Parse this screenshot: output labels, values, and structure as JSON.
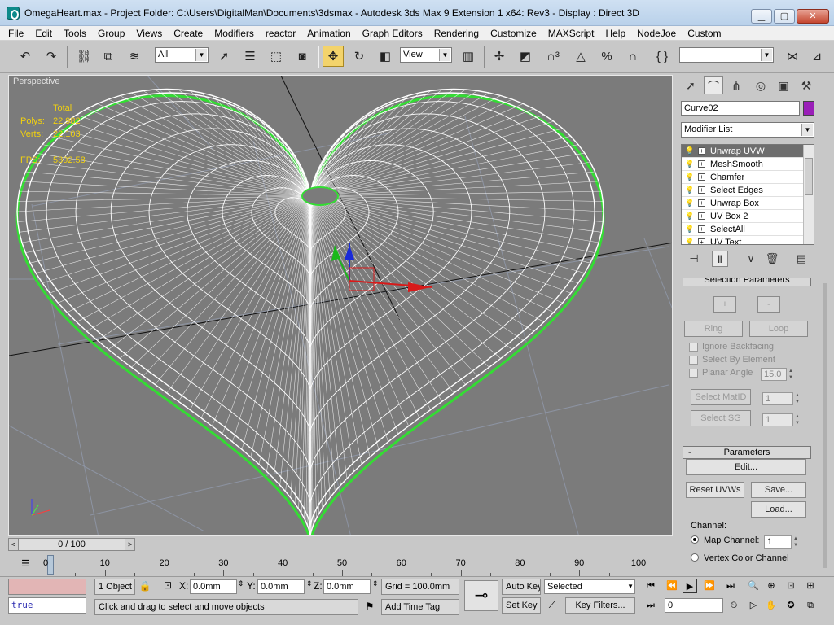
{
  "window": {
    "title": "OmegaHeart.max    - Project Folder: C:\\Users\\DigitalMan\\Documents\\3dsmax    - Autodesk 3ds Max 9 Extension 1 x64: Rev3      - Display : Direct 3D",
    "min_label": "▁",
    "max_label": "▢",
    "close_label": "✕"
  },
  "menu": [
    "File",
    "Edit",
    "Tools",
    "Group",
    "Views",
    "Create",
    "Modifiers",
    "reactor",
    "Animation",
    "Graph Editors",
    "Rendering",
    "Customize",
    "MAXScript",
    "Help",
    "NodeJoe",
    "Custom"
  ],
  "toolbar": {
    "selection_filter": "All",
    "ref_coord": "View",
    "named_selection": ""
  },
  "viewport": {
    "label": "Perspective",
    "stats": {
      "header": "Total",
      "polys_label": "Polys:",
      "polys_value": "22,982",
      "verts_label": "Verts:",
      "verts_value": "22,103",
      "fps_label": "FPS:",
      "fps_value": "5392.58"
    },
    "stats_color": "#f0d010",
    "background": "#7b7b7b",
    "wire_color": "#ffffff",
    "edge_color": "#33dd33"
  },
  "command_panel": {
    "object_name": "Curve02",
    "object_color": "#9a1fb8",
    "modifier_list_label": "Modifier List",
    "stack": [
      "Unwrap UVW",
      "MeshSmooth",
      "Chamfer",
      "Select Edges",
      "Unwrap Box",
      "UV Box 2",
      "SelectAll",
      "UV Text"
    ],
    "selection_params_title": "Selection Parameters",
    "plus_label": "+",
    "minus_label": "-",
    "ring_label": "Ring",
    "loop_label": "Loop",
    "ignore_backfacing": "Ignore Backfacing",
    "select_by_element": "Select By Element",
    "planar_angle_label": "Planar Angle",
    "planar_angle_value": "15.0",
    "select_matid_label": "Select MatID",
    "matid_value": "1",
    "select_sg_label": "Select SG",
    "sg_value": "1",
    "parameters_title": "Parameters",
    "parameters_collapse": "-",
    "edit_label": "Edit...",
    "reset_uvws_label": "Reset UVWs",
    "save_label": "Save...",
    "load_label": "Load...",
    "channel_label": "Channel:",
    "map_channel_label": "Map Channel:",
    "map_channel_value": "1",
    "vertex_color_label": "Vertex Color Channel"
  },
  "timeline": {
    "frame_text": "0 / 100",
    "ticks": [
      "0",
      "10",
      "20",
      "30",
      "40",
      "50",
      "60",
      "70",
      "80",
      "90",
      "100"
    ]
  },
  "status": {
    "listener_text": "true",
    "object_count": "1 Object",
    "x_label": "X:",
    "x_value": "0.0mm",
    "y_label": "Y:",
    "y_value": "0.0mm",
    "z_label": "Z:",
    "z_value": "0.0mm",
    "grid": "Grid = 100.0mm",
    "prompt": "Click and drag to select and move objects",
    "add_time_tag": "Add Time Tag",
    "auto_key": "Auto Key",
    "set_key": "Set Key",
    "key_mode": "Selected",
    "key_filters": "Key Filters...",
    "current_frame": "0"
  }
}
